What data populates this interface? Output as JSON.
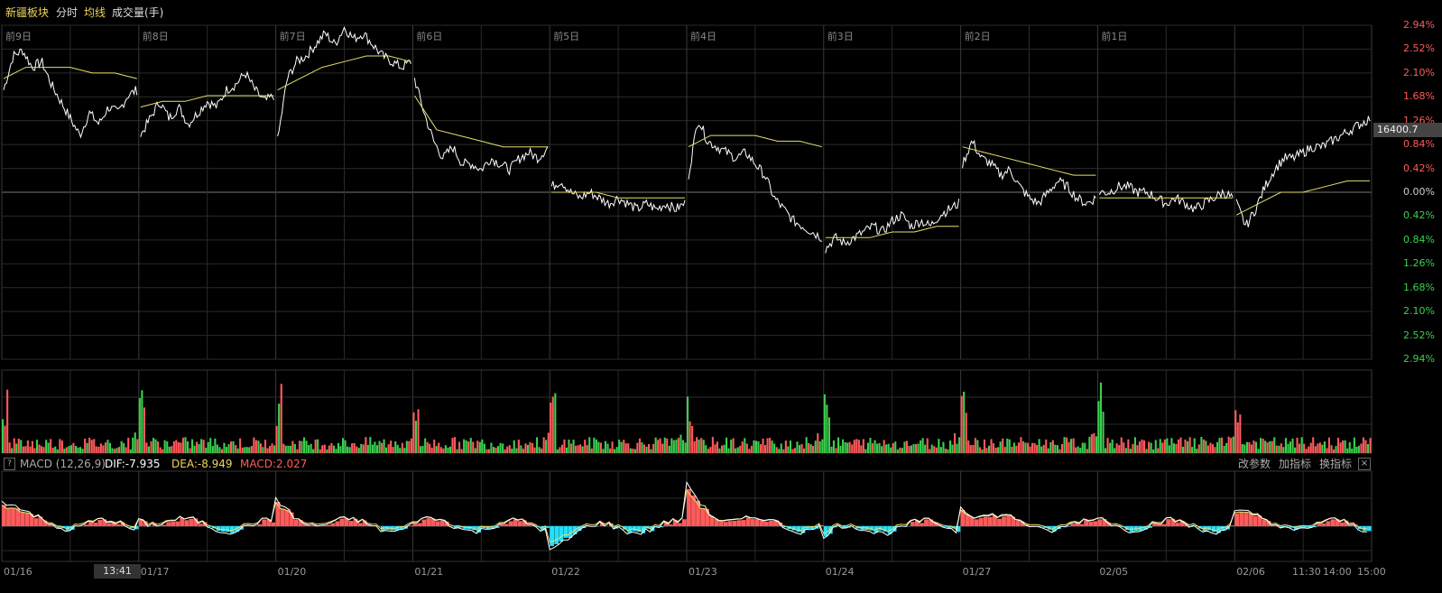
{
  "header": {
    "sector_name": "新疆板块",
    "tab_timeshare": "分时",
    "tab_avg_line": "均线",
    "tab_volume": "成交量(手)"
  },
  "colors": {
    "up": "#ff5b5b",
    "down": "#3ccf4e",
    "price_line": "#ffffff",
    "avg_line": "#e8e06a",
    "macd_pos": "#ff5b5b",
    "macd_neg": "#22e0ff",
    "grid": "#2a2a2a",
    "zero_line": "#777"
  },
  "day_labels": [
    "前9日",
    "前8日",
    "前7日",
    "前6日",
    "前5日",
    "前4日",
    "前3日",
    "前2日",
    "前1日"
  ],
  "date_labels": [
    "01/16",
    "01/17",
    "01/20",
    "01/21",
    "01/22",
    "01/23",
    "01/24",
    "01/27",
    "02/05",
    "02/06",
    "11:30",
    "14:00",
    "15:00"
  ],
  "crosshair_time": "13:41",
  "current_price": "16400.7",
  "macd": {
    "name": "MACD (12,26,9)",
    "dif": "DIF:-7.935",
    "dea": "DEA:-8.949",
    "macd": "MACD:2.027",
    "help": "?",
    "btn_params": "改参数",
    "btn_add": "加指标",
    "btn_switch": "换指标",
    "btn_close": "×"
  },
  "chart_data": {
    "type": "line",
    "title": "新疆板块",
    "ylim": [
      -2.94,
      2.94
    ],
    "y_ticks": [
      {
        "label": "2.94%",
        "value": 2.94
      },
      {
        "label": "2.52%",
        "value": 2.52
      },
      {
        "label": "2.10%",
        "value": 2.1
      },
      {
        "label": "1.68%",
        "value": 1.68
      },
      {
        "label": "1.26%",
        "value": 1.26
      },
      {
        "label": "0.84%",
        "value": 0.84
      },
      {
        "label": "0.42%",
        "value": 0.42
      },
      {
        "label": "0.00%",
        "value": 0.0
      },
      {
        "label": "0.42%",
        "value": -0.42
      },
      {
        "label": "0.84%",
        "value": -0.84
      },
      {
        "label": "1.26%",
        "value": -1.26
      },
      {
        "label": "1.68%",
        "value": -1.68
      },
      {
        "label": "2.10%",
        "value": -2.1
      },
      {
        "label": "2.52%",
        "value": -2.52
      },
      {
        "label": "2.94%",
        "value": -2.94
      }
    ],
    "days": [
      "01/16",
      "01/17",
      "01/20",
      "01/21",
      "01/22",
      "01/23",
      "01/24",
      "01/27",
      "02/05",
      "02/06"
    ],
    "series": [
      {
        "type": "price",
        "days": [
          [
            1.8,
            2.4,
            2.5,
            2.2,
            2.3,
            1.9,
            1.6,
            1.3,
            1.0,
            1.4,
            1.2,
            1.5,
            1.4,
            1.7,
            1.8
          ],
          [
            1.0,
            1.3,
            1.6,
            1.3,
            1.5,
            1.2,
            1.4,
            1.6,
            1.5,
            1.8,
            1.9,
            2.1,
            1.8,
            1.6,
            1.7
          ],
          [
            0.9,
            2.0,
            2.3,
            2.4,
            2.6,
            2.8,
            2.6,
            2.9,
            2.7,
            2.8,
            2.6,
            2.4,
            2.3,
            2.2,
            2.3
          ],
          [
            2.0,
            1.4,
            0.9,
            0.6,
            0.8,
            0.5,
            0.5,
            0.4,
            0.6,
            0.5,
            0.4,
            0.6,
            0.7,
            0.6,
            0.8
          ],
          [
            0.1,
            0.2,
            0.0,
            -0.1,
            0.0,
            -0.1,
            -0.2,
            -0.1,
            -0.2,
            -0.3,
            -0.2,
            -0.3,
            -0.2,
            -0.3,
            -0.2
          ],
          [
            0.3,
            1.3,
            0.9,
            0.8,
            0.7,
            0.6,
            0.7,
            0.5,
            0.3,
            -0.1,
            -0.3,
            -0.5,
            -0.6,
            -0.7,
            -0.8
          ],
          [
            -1.0,
            -0.8,
            -0.9,
            -0.8,
            -0.7,
            -0.6,
            -0.7,
            -0.5,
            -0.4,
            -0.6,
            -0.5,
            -0.6,
            -0.4,
            -0.3,
            -0.2
          ],
          [
            0.5,
            0.9,
            0.6,
            0.5,
            0.3,
            0.4,
            0.1,
            -0.1,
            -0.2,
            0.0,
            0.2,
            0.1,
            -0.1,
            -0.2,
            -0.1
          ],
          [
            0.0,
            0.0,
            0.1,
            0.1,
            0.0,
            0.0,
            -0.1,
            -0.2,
            -0.1,
            -0.2,
            -0.3,
            -0.2,
            -0.1,
            0.0,
            -0.1
          ],
          [
            -0.2,
            -0.6,
            -0.3,
            0.1,
            0.4,
            0.6,
            0.6,
            0.7,
            0.8,
            0.8,
            0.9,
            1.0,
            1.1,
            1.2,
            1.3
          ]
        ]
      },
      {
        "type": "avg",
        "days": [
          [
            2.0,
            2.2,
            2.2,
            2.2,
            2.1,
            2.1,
            2.0
          ],
          [
            1.5,
            1.6,
            1.6,
            1.7,
            1.7,
            1.7,
            1.7
          ],
          [
            1.8,
            2.0,
            2.2,
            2.3,
            2.4,
            2.4,
            2.3
          ],
          [
            1.7,
            1.1,
            1.0,
            0.9,
            0.8,
            0.8,
            0.8
          ],
          [
            0.0,
            0.0,
            0.0,
            -0.1,
            -0.1,
            -0.1,
            -0.1
          ],
          [
            0.8,
            1.0,
            1.0,
            1.0,
            0.9,
            0.9,
            0.8
          ],
          [
            -0.8,
            -0.8,
            -0.8,
            -0.7,
            -0.7,
            -0.6,
            -0.6
          ],
          [
            0.8,
            0.7,
            0.6,
            0.5,
            0.4,
            0.3,
            0.3
          ],
          [
            -0.1,
            -0.1,
            -0.1,
            -0.1,
            -0.1,
            -0.1,
            -0.1
          ],
          [
            -0.4,
            -0.2,
            0.0,
            0.0,
            0.1,
            0.2,
            0.2
          ]
        ]
      }
    ]
  }
}
